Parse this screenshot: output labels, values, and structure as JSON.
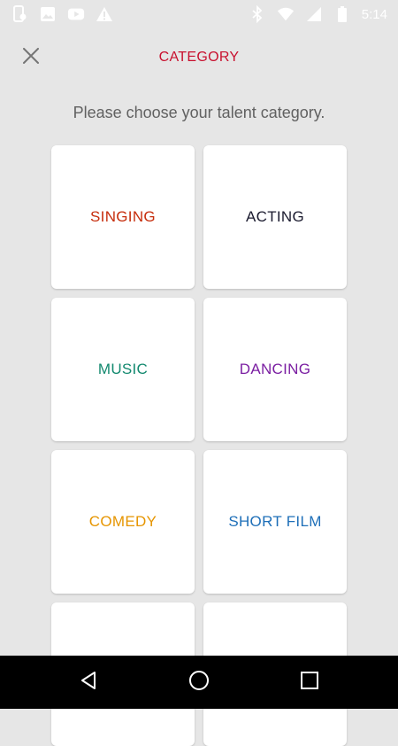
{
  "status_bar": {
    "time": "5:14",
    "left_icons": [
      "phone-sync-icon",
      "image-icon",
      "youtube-icon",
      "warning-icon"
    ],
    "right_icons": [
      "bluetooth-icon",
      "wifi-icon",
      "signal-icon",
      "battery-icon"
    ]
  },
  "header": {
    "title": "CATEGORY",
    "close_icon": "close-icon"
  },
  "prompt": "Please choose your talent category.",
  "categories": [
    {
      "label": "SINGING",
      "color": "#c62d0c"
    },
    {
      "label": "ACTING",
      "color": "#1b1b2f"
    },
    {
      "label": "MUSIC",
      "color": "#13896f"
    },
    {
      "label": "DANCING",
      "color": "#7b1fa2"
    },
    {
      "label": "COMEDY",
      "color": "#e69500"
    },
    {
      "label": "SHORT FILM",
      "color": "#1e6fb8"
    },
    {
      "label": "",
      "color": "#000000"
    },
    {
      "label": "",
      "color": "#000000"
    }
  ],
  "nav_bar": {
    "buttons": [
      "back-icon",
      "home-icon",
      "recents-icon"
    ]
  },
  "colors": {
    "accent": "#c8102e",
    "background": "#e6e6e6"
  }
}
